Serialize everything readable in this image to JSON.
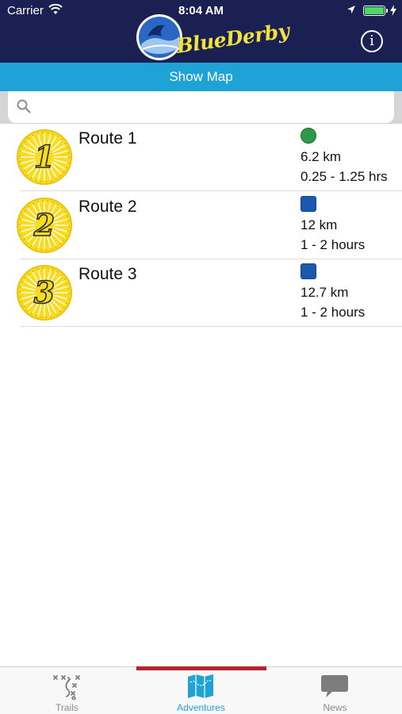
{
  "status_bar": {
    "carrier": "Carrier",
    "time": "8:04 AM"
  },
  "header": {
    "logo_text": "BlueDerby",
    "info_label": "i"
  },
  "show_map": {
    "label": "Show Map"
  },
  "search": {
    "value": "",
    "placeholder": ""
  },
  "routes": [
    {
      "badge_number": "1",
      "title": "Route 1",
      "difficulty": "green-circle",
      "distance": "6.2 km",
      "duration": "0.25 - 1.25 hrs"
    },
    {
      "badge_number": "2",
      "title": "Route 2",
      "difficulty": "blue-square",
      "distance": "12 km",
      "duration": "1 - 2 hours"
    },
    {
      "badge_number": "3",
      "title": "Route 3",
      "difficulty": "blue-square",
      "distance": "12.7 km",
      "duration": "1 - 2 hours"
    }
  ],
  "tabs": [
    {
      "label": "Trails",
      "icon": "trails-icon",
      "active": false
    },
    {
      "label": "Adventures",
      "icon": "map-icon",
      "active": true
    },
    {
      "label": "News",
      "icon": "speech-bubble-icon",
      "active": false
    }
  ],
  "colors": {
    "header_bg": "#1a2152",
    "show_map_bg": "#1fa2d6",
    "active_tab_indicator": "#b5232a",
    "badge_yellow": "#f7dc22",
    "green_circle": "#2e9a48",
    "blue_square": "#1d58b0"
  }
}
